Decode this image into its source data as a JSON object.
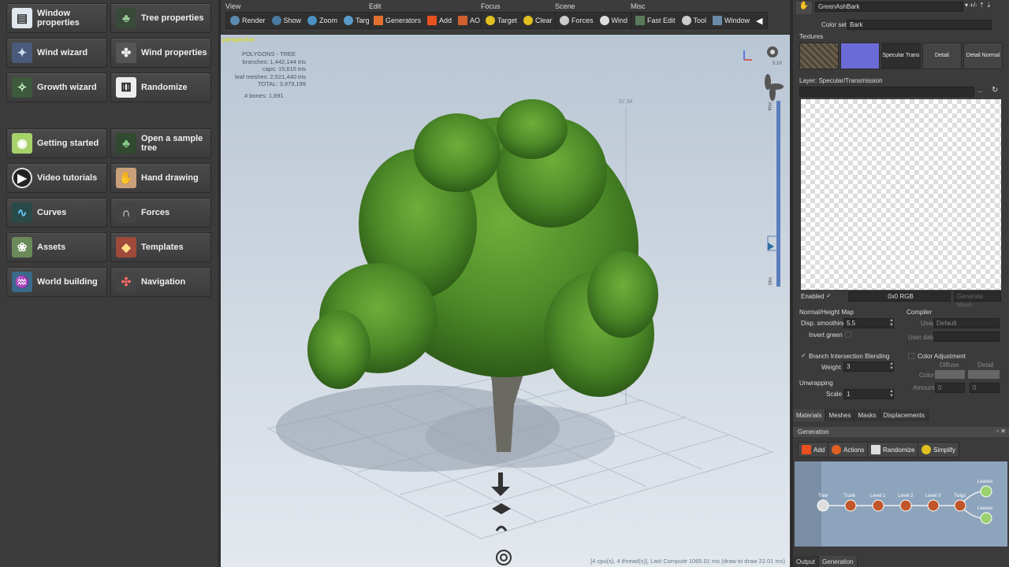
{
  "left_panel": {
    "buttons": [
      {
        "label": "Window properties",
        "icon": "window-properties-icon"
      },
      {
        "label": "Tree properties",
        "icon": "tree-properties-icon"
      },
      {
        "label": "Wind wizard",
        "icon": "wind-wizard-icon"
      },
      {
        "label": "Wind properties",
        "icon": "wind-properties-icon"
      },
      {
        "label": "Growth wizard",
        "icon": "growth-wizard-icon"
      },
      {
        "label": "Randomize",
        "icon": "dice-icon"
      },
      {
        "label": "Getting started",
        "icon": "getting-started-icon"
      },
      {
        "label": "Open a sample tree",
        "icon": "sample-tree-icon"
      },
      {
        "label": "Video tutorials",
        "icon": "play-icon"
      },
      {
        "label": "Hand drawing",
        "icon": "hand-icon"
      },
      {
        "label": "Curves",
        "icon": "curves-icon"
      },
      {
        "label": "Forces",
        "icon": "magnet-icon"
      },
      {
        "label": "Assets",
        "icon": "assets-icon"
      },
      {
        "label": "Templates",
        "icon": "templates-icon"
      },
      {
        "label": "World building",
        "icon": "world-icon"
      },
      {
        "label": "Navigation",
        "icon": "navigation-icon"
      }
    ]
  },
  "toolbar": {
    "groups": [
      {
        "label": "View",
        "buttons": [
          "Render",
          "Show",
          "Zoom",
          "Target"
        ]
      },
      {
        "label": "Edit",
        "buttons": [
          "Generators",
          "Add",
          "AO"
        ]
      },
      {
        "label": "Focus",
        "buttons": [
          "Target",
          "Clear"
        ]
      },
      {
        "label": "Scene",
        "buttons": [
          "Forces",
          "Wind"
        ]
      },
      {
        "label": "Misc",
        "buttons": [
          "Fast Edit",
          "Tool",
          "Window"
        ]
      }
    ]
  },
  "viewport": {
    "mode": "perspective",
    "stats_title": "POLYGONS - TREE",
    "stats": [
      "branches: 1,442,144 tris",
      "caps: 15,615 tris",
      "leaf meshes: 2,521,440 tris",
      "TOTAL: 3,979,199"
    ],
    "bones": "# bones: 1,691",
    "height_value": "57.34",
    "light_value": "5.10",
    "slider_max": "Max",
    "slider_min": "Min",
    "status": "[4 cpu(s), 4 thread(s)], Last Compute 1065.01 ms (draw to draw 22.01 ms)"
  },
  "right_panel": {
    "material_name": "GreenAshBark",
    "color_set_label": "Color set",
    "color_set_value": "Bark",
    "textures_label": "Textures",
    "texture_buttons": [
      "Specular Trans",
      "Detail",
      "Detail Normal"
    ],
    "layer_label": "Layer: Specular/Transmission",
    "enabled_label": "Enabled",
    "resolution": "0x0  RGB",
    "generate_mesh": "Generate Mesh",
    "normal_height_label": "Normal/Height Map",
    "disp_smoothing_label": "Disp. smoothing",
    "disp_smoothing_value": "5.5",
    "invert_green_label": "Invert green",
    "compiler_label": "Compiler",
    "usage_label": "Usage",
    "usage_value": "Default",
    "user_data_label": "User data",
    "branch_blending_label": "Branch Intersection Blending",
    "weight_label": "Weight",
    "weight_value": "3",
    "color_adjustment_label": "Color Adjustment",
    "diffuse_label": "Diffuse",
    "detail_label": "Detail",
    "color_label": "Color",
    "amount_label": "Amount",
    "amount_a": "0",
    "amount_b": "0",
    "unwrapping_label": "Unwrapping",
    "scale_label": "Scale",
    "scale_value": "1",
    "tabs": [
      "Materials",
      "Meshes",
      "Masks",
      "Displacements"
    ],
    "generation_title": "Generation",
    "generation_buttons": [
      "Add",
      "Actions",
      "Randomize",
      "Simplify"
    ],
    "nodes": [
      "Tree",
      "Trunk",
      "Level 1",
      "Level 2",
      "Level 3",
      "Twigs",
      "Leaves",
      "Leaves"
    ],
    "bottom_tabs": [
      "Output",
      "Generation"
    ]
  },
  "colors": {
    "accent_yellow": "#e5e400",
    "panel": "#3b3b3b",
    "viewport_sky": "#b9c6d4",
    "node_orange": "#c0562a"
  }
}
